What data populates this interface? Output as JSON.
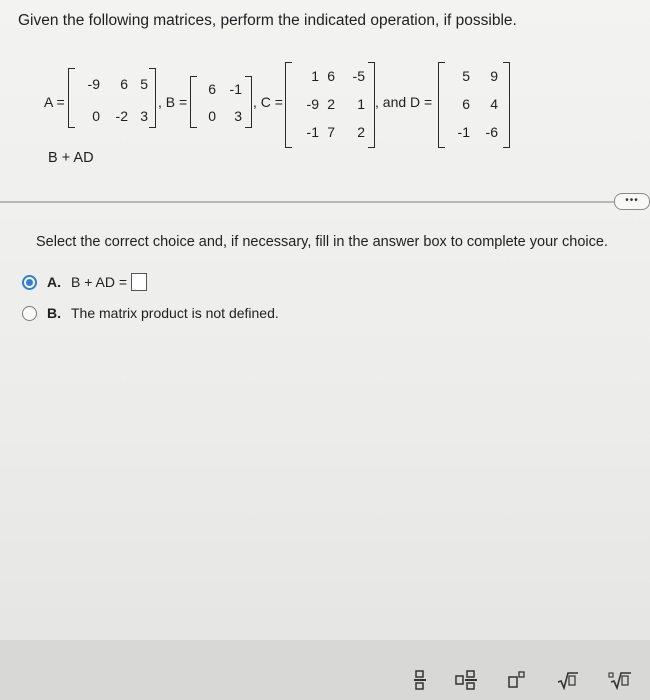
{
  "prompt": "Given the following matrices, perform the indicated operation, if possible.",
  "matrices": {
    "A": {
      "label": "A =",
      "rows": [
        [
          "-9",
          "6",
          "5"
        ],
        [
          "0",
          "-2",
          "3"
        ]
      ]
    },
    "B": {
      "label": ", B =",
      "rows": [
        [
          "6",
          "-1"
        ],
        [
          "0",
          "3"
        ]
      ]
    },
    "C": {
      "label": ", C =",
      "rows": [
        [
          "1",
          "6",
          "-5"
        ],
        [
          "-9",
          "2",
          "1"
        ],
        [
          "-1",
          "7",
          "2"
        ]
      ]
    },
    "D": {
      "label": ", and D =",
      "rows": [
        [
          "5",
          "9"
        ],
        [
          "6",
          "4"
        ],
        [
          "-1",
          "-6"
        ]
      ]
    }
  },
  "operation": "B + AD",
  "more_button": "•••",
  "instruction": "Select the correct choice and, if necessary, fill in the answer box to complete your choice.",
  "choices": [
    {
      "letter": "A.",
      "text": "B + AD =",
      "selected": true
    },
    {
      "letter": "B.",
      "text": "The matrix product is not defined.",
      "selected": false
    }
  ],
  "toolbar": [
    "fraction-icon",
    "mixed-number-icon",
    "exponent-icon",
    "square-root-icon",
    "nth-root-icon"
  ]
}
